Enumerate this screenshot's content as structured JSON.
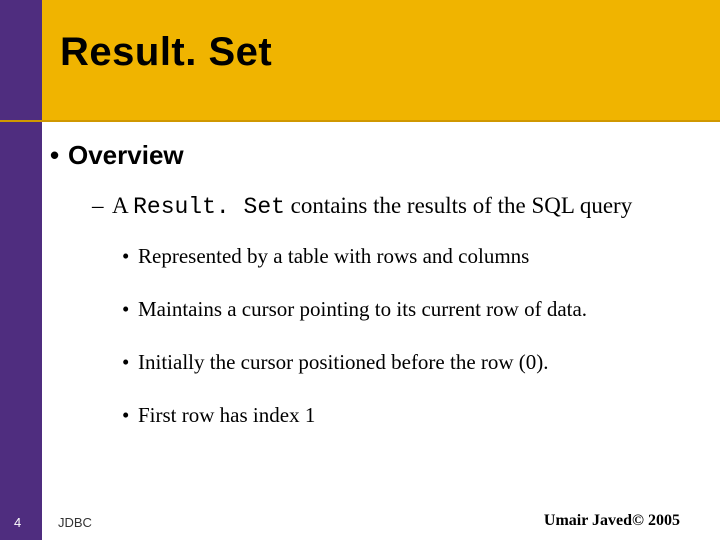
{
  "title": "Result. Set",
  "heading": "Overview",
  "sub": {
    "prefix": "A ",
    "code": "Result. Set",
    "suffix": " contains the results of the SQL query"
  },
  "points": [
    "Represented by a table with rows and columns",
    "Maintains a cursor pointing to its current row of data.",
    "Initially the cursor positioned before the row (0).",
    "First row has index 1"
  ],
  "footer": {
    "slide_number": "4",
    "left": "JDBC",
    "right": "Umair Javed© 2005"
  }
}
